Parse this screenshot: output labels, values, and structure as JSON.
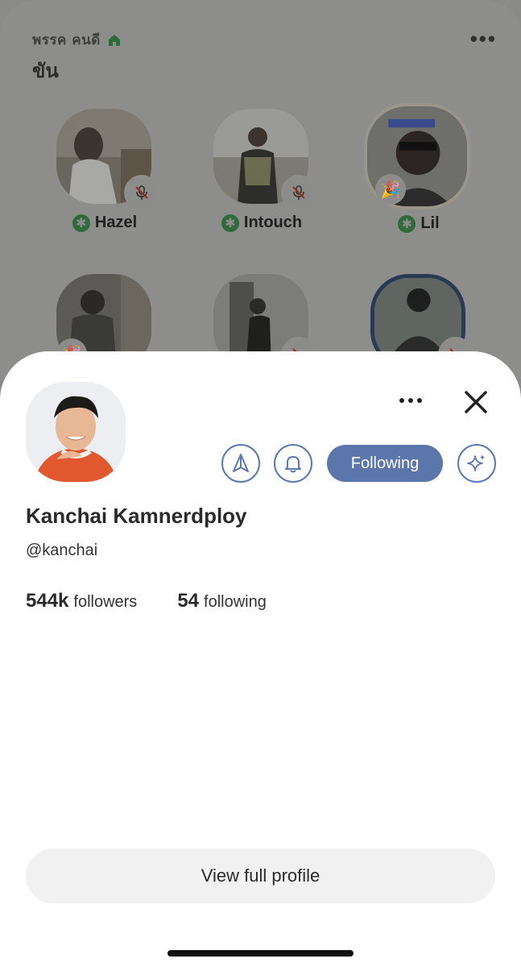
{
  "room": {
    "club_name": "พรรค คนดี",
    "topic": "ขัน",
    "speakers_row1": [
      {
        "name": "Hazel",
        "badge": "mic-muted"
      },
      {
        "name": "Intouch",
        "badge": "mic-muted"
      },
      {
        "name": "Lil",
        "badge": "party-popper"
      }
    ],
    "speakers_row2": [
      {
        "badge": "party-popper"
      },
      {
        "badge": "mic-muted"
      },
      {
        "badge": "mic-muted"
      }
    ],
    "party_emoji": "🎉",
    "moderator_glyph": "✱"
  },
  "profile": {
    "full_name": "Kanchai Kamnerdploy",
    "username": "@kanchai",
    "followers_count": "544k",
    "followers_label": "followers",
    "following_count": "54",
    "following_label": "following",
    "follow_button": "Following",
    "view_full_profile": "View full profile"
  },
  "colors": {
    "accent": "#5b76ab",
    "moderator_green": "#2f6b3a",
    "mute_red": "#c0392b"
  }
}
